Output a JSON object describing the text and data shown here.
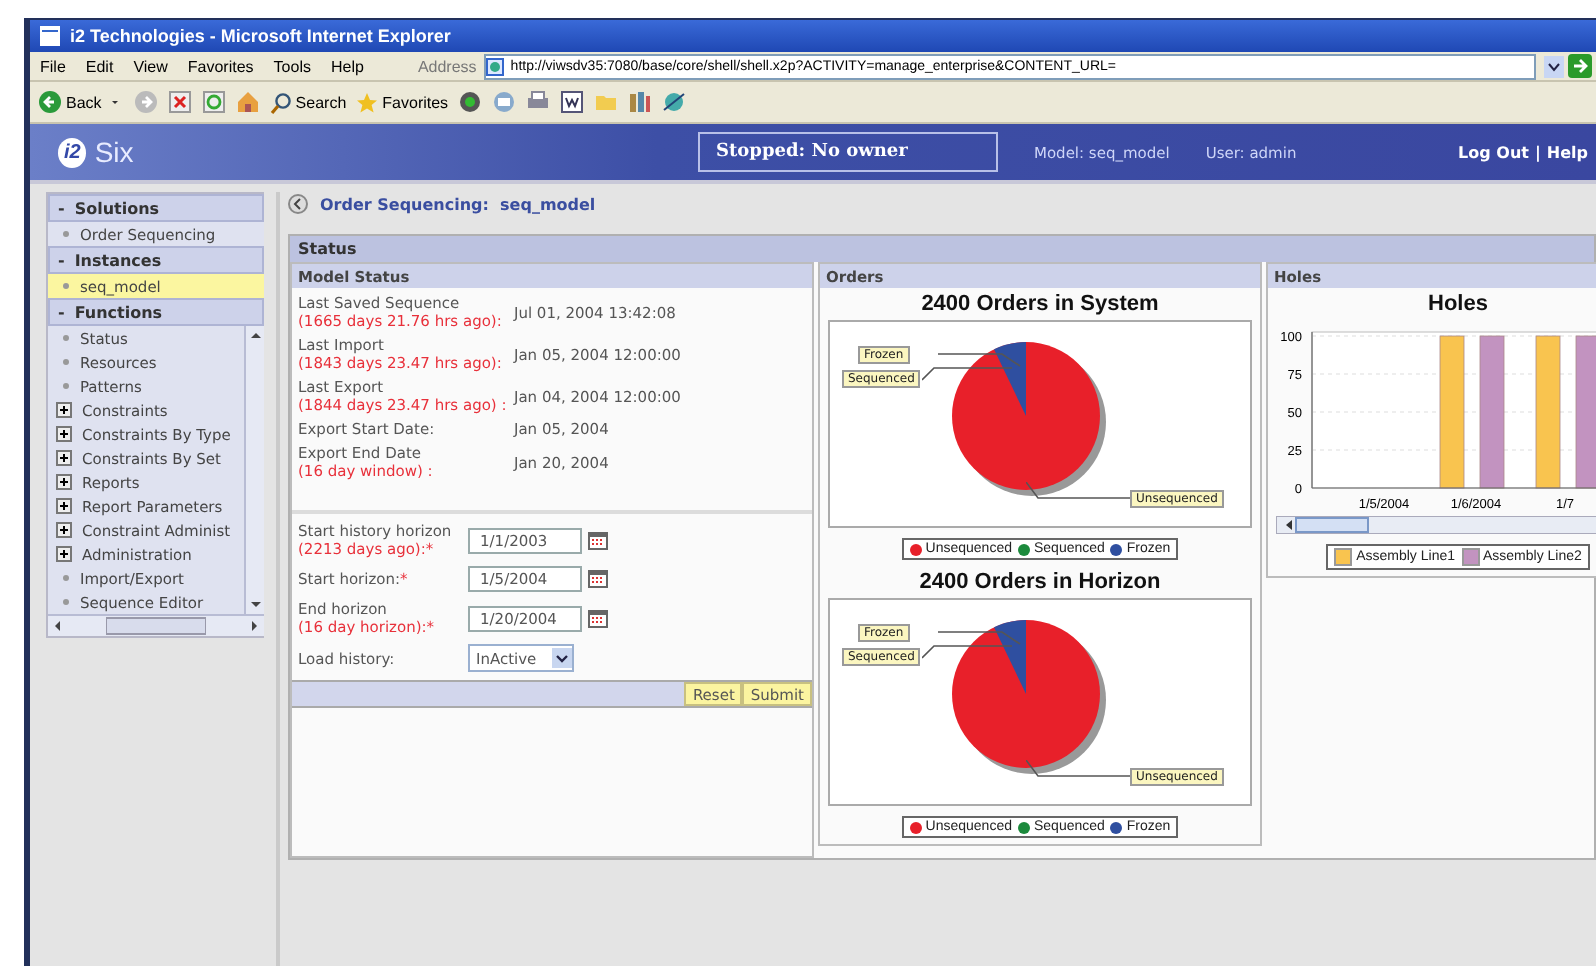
{
  "window": {
    "title": "i2 Technologies - Microsoft Internet Explorer"
  },
  "menu": [
    "File",
    "Edit",
    "View",
    "Favorites",
    "Tools",
    "Help"
  ],
  "toolbar": {
    "back": "Back",
    "search": "Search",
    "favorites": "Favorites"
  },
  "address": {
    "label": "Address",
    "url": "http://viwsdv35:7080/base/core/shell/shell.x2p?ACTIVITY=manage_enterprise&CONTENT_URL="
  },
  "app_header": {
    "logo": "i2",
    "product": "Six",
    "status": "Stopped: No owner",
    "model": "Model: seq_model",
    "user": "User: admin",
    "links": [
      "Log Out",
      "Help"
    ],
    "separator": "|"
  },
  "sidebar": {
    "sections": [
      {
        "title": "Solutions",
        "toggle": "-",
        "scroll": false,
        "items": [
          {
            "label": "Order Sequencing",
            "kind": "leaf",
            "selected": false
          }
        ]
      },
      {
        "title": "Instances",
        "toggle": "-",
        "scroll": false,
        "items": [
          {
            "label": "seq_model",
            "kind": "leaf",
            "selected": true
          }
        ]
      },
      {
        "title": "Functions",
        "toggle": "-",
        "scroll": true,
        "items": [
          {
            "label": "Status",
            "kind": "leaf",
            "selected": false
          },
          {
            "label": "Resources",
            "kind": "leaf",
            "selected": false
          },
          {
            "label": "Patterns",
            "kind": "leaf",
            "selected": false
          },
          {
            "label": "Constraints",
            "kind": "group",
            "selected": false
          },
          {
            "label": "Constraints By Type",
            "kind": "group",
            "selected": false
          },
          {
            "label": "Constraints By Set",
            "kind": "group",
            "selected": false
          },
          {
            "label": "Reports",
            "kind": "group",
            "selected": false
          },
          {
            "label": "Report Parameters",
            "kind": "group",
            "selected": false
          },
          {
            "label": "Constraint Administ",
            "kind": "group",
            "selected": false
          },
          {
            "label": "Administration",
            "kind": "group",
            "selected": false
          },
          {
            "label": "Import/Export",
            "kind": "leaf",
            "selected": false
          },
          {
            "label": "Sequence Editor",
            "kind": "leaf",
            "selected": false
          }
        ]
      }
    ]
  },
  "breadcrumb": "Order Sequencing:  seq_model",
  "status_panel": {
    "title": "Status",
    "model_status": {
      "title": "Model Status",
      "rows": [
        {
          "label": "Last Saved Sequence",
          "note": "(1665 days 21.76 hrs ago):",
          "value": "Jul 01, 2004 13:42:08"
        },
        {
          "label": "Last Import",
          "note": "(1843 days 23.47 hrs ago):",
          "value": "Jan 05, 2004 12:00:00"
        },
        {
          "label": "Last Export",
          "note": "(1844 days 23.47 hrs ago) :",
          "value": "Jan 04, 2004 12:00:00"
        },
        {
          "label": "Export Start Date:",
          "value": "Jan 05, 2004"
        },
        {
          "label": "Export End Date",
          "note": "(16 day window) :",
          "value": "Jan 20, 2004"
        }
      ]
    },
    "form": {
      "fields": [
        {
          "label": "Start history horizon",
          "note": "(2213 days ago):",
          "mark": "*",
          "kind": "date",
          "value": "1/1/2003"
        },
        {
          "label": "Start horizon:",
          "mark": "*",
          "kind": "date",
          "value": "1/5/2004"
        },
        {
          "label": "End horizon",
          "note": "(16 day horizon):",
          "mark": "*",
          "kind": "date",
          "value": "1/20/2004"
        },
        {
          "label": "Load history:",
          "kind": "select",
          "value": "InActive"
        }
      ],
      "buttons": [
        "Reset",
        "Submit"
      ]
    }
  },
  "orders": {
    "title": "Orders",
    "charts": [
      {
        "title": "2400 Orders in System",
        "slice_labels": [
          "Frozen",
          "Sequenced",
          "Unsequenced"
        ],
        "legend": [
          {
            "label": "Unsequenced",
            "color": "#e8202a"
          },
          {
            "label": "Sequenced",
            "color": "#1c8a3c"
          },
          {
            "label": "Frozen",
            "color": "#2f4fa0"
          }
        ]
      },
      {
        "title": "2400 Orders in Horizon",
        "slice_labels": [
          "Frozen",
          "Sequenced",
          "Unsequenced"
        ],
        "legend": [
          {
            "label": "Unsequenced",
            "color": "#e8202a"
          },
          {
            "label": "Sequenced",
            "color": "#1c8a3c"
          },
          {
            "label": "Frozen",
            "color": "#2f4fa0"
          }
        ]
      }
    ]
  },
  "holes": {
    "title": "Holes",
    "chart_data": {
      "type": "bar",
      "title": "Holes",
      "grid": true,
      "legend": true,
      "categories": [
        "1/5/2004",
        "1/6/2004",
        "1/7"
      ],
      "ylim": [
        0,
        100
      ],
      "yticks": [
        0,
        25,
        50,
        75,
        100
      ],
      "series": [
        {
          "name": "Assembly Line1",
          "color": "#f9c44f",
          "values": [
            0,
            100,
            100
          ]
        },
        {
          "name": "Assembly Line2",
          "color": "#c293c0",
          "values": [
            0,
            100,
            100
          ]
        }
      ]
    }
  }
}
